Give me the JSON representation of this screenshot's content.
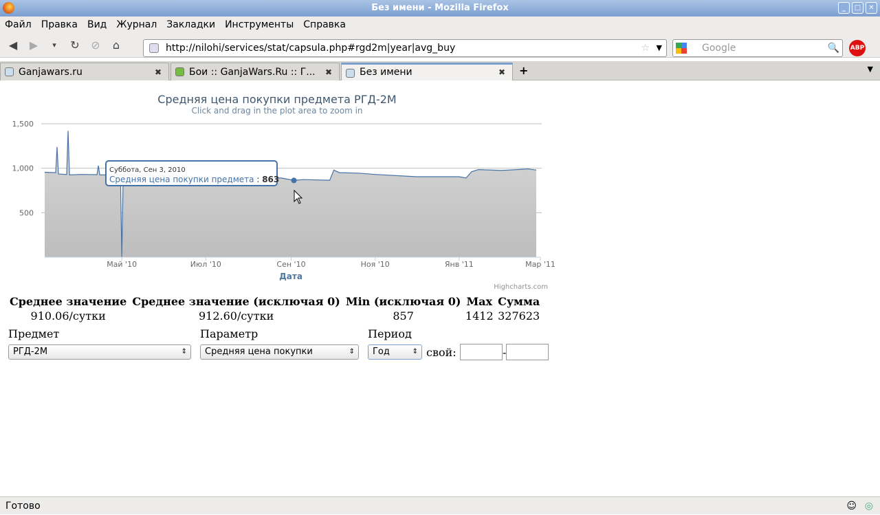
{
  "window": {
    "title": "Без имени - Mozilla Firefox"
  },
  "menu": [
    "Файл",
    "Правка",
    "Вид",
    "Журнал",
    "Закладки",
    "Инструменты",
    "Справка"
  ],
  "url": "http://nilohi/services/stat/capsula.php#rgd2m|year|avg_buy",
  "search_placeholder": "Google",
  "abp": "ABP",
  "tabs": [
    "Ganjawars.ru",
    "Бои :: GanjaWars.Ru :: Г...",
    "Без имени"
  ],
  "chart_data": {
    "type": "area",
    "title": "Средняя цена покупки предмета РГД-2М",
    "subtitle": "Click and drag in the plot area to zoom in",
    "xlabel": "Дата",
    "ylabel": "",
    "ylim": [
      0,
      1500
    ],
    "yticks": [
      "500",
      "1,000",
      "1,500"
    ],
    "ytick_values": [
      500,
      1000,
      1500
    ],
    "xticks": [
      "Май '10",
      "Июл '10",
      "Сен '10",
      "Ноя '10",
      "Янв '11",
      "Мар '11"
    ],
    "xtick_dates": [
      "2010-05-01",
      "2010-07-01",
      "2010-09-01",
      "2010-11-01",
      "2011-01-01",
      "2011-03-01"
    ],
    "xlim": [
      "2010-03-06",
      "2011-03-01"
    ],
    "series": [
      {
        "name": "Средняя цена покупки предмета",
        "color": "#4572a7",
        "points": [
          [
            "2010-03-06",
            955
          ],
          [
            "2010-03-14",
            950
          ],
          [
            "2010-03-15",
            1240
          ],
          [
            "2010-03-16",
            935
          ],
          [
            "2010-03-22",
            930
          ],
          [
            "2010-03-23",
            1420
          ],
          [
            "2010-03-24",
            925
          ],
          [
            "2010-04-01",
            930
          ],
          [
            "2010-04-13",
            928
          ],
          [
            "2010-04-14",
            1030
          ],
          [
            "2010-04-15",
            925
          ],
          [
            "2010-04-30",
            925
          ],
          [
            "2010-05-01",
            0
          ],
          [
            "2010-05-02",
            925
          ],
          [
            "2010-06-01",
            915
          ],
          [
            "2010-07-01",
            905
          ],
          [
            "2010-08-01",
            895
          ],
          [
            "2010-08-25",
            890
          ],
          [
            "2010-09-03",
            863
          ],
          [
            "2010-09-10",
            872
          ],
          [
            "2010-09-29",
            865
          ],
          [
            "2010-10-02",
            980
          ],
          [
            "2010-10-06",
            950
          ],
          [
            "2010-10-20",
            945
          ],
          [
            "2010-11-01",
            930
          ],
          [
            "2010-12-01",
            905
          ],
          [
            "2011-01-01",
            905
          ],
          [
            "2011-01-06",
            890
          ],
          [
            "2011-01-10",
            960
          ],
          [
            "2011-01-15",
            985
          ],
          [
            "2011-02-01",
            975
          ],
          [
            "2011-02-20",
            992
          ],
          [
            "2011-02-26",
            980
          ]
        ]
      }
    ],
    "tooltip": {
      "date": "Суббота, Сен 3, 2010",
      "series": "Средняя цена покупки предмета",
      "value": "863",
      "point_date": "2010-09-03",
      "point_value": 863
    },
    "credits": "Highcharts.com"
  },
  "stats": {
    "headers": [
      "Среднее значение",
      "Среднее значение (исключая 0)",
      "Min (исключая 0)",
      "Max",
      "Сумма"
    ],
    "values": [
      "910.06/сутки",
      "912.60/сутки",
      "857",
      "1412",
      "327623"
    ]
  },
  "form": {
    "item_label": "Предмет",
    "item_value": "РГД-2М",
    "param_label": "Параметр",
    "param_value": "Средняя цена покупки",
    "period_label": "Период",
    "period_value": "Год",
    "custom_label": "свой:",
    "dash": "-"
  },
  "status": "Готово"
}
